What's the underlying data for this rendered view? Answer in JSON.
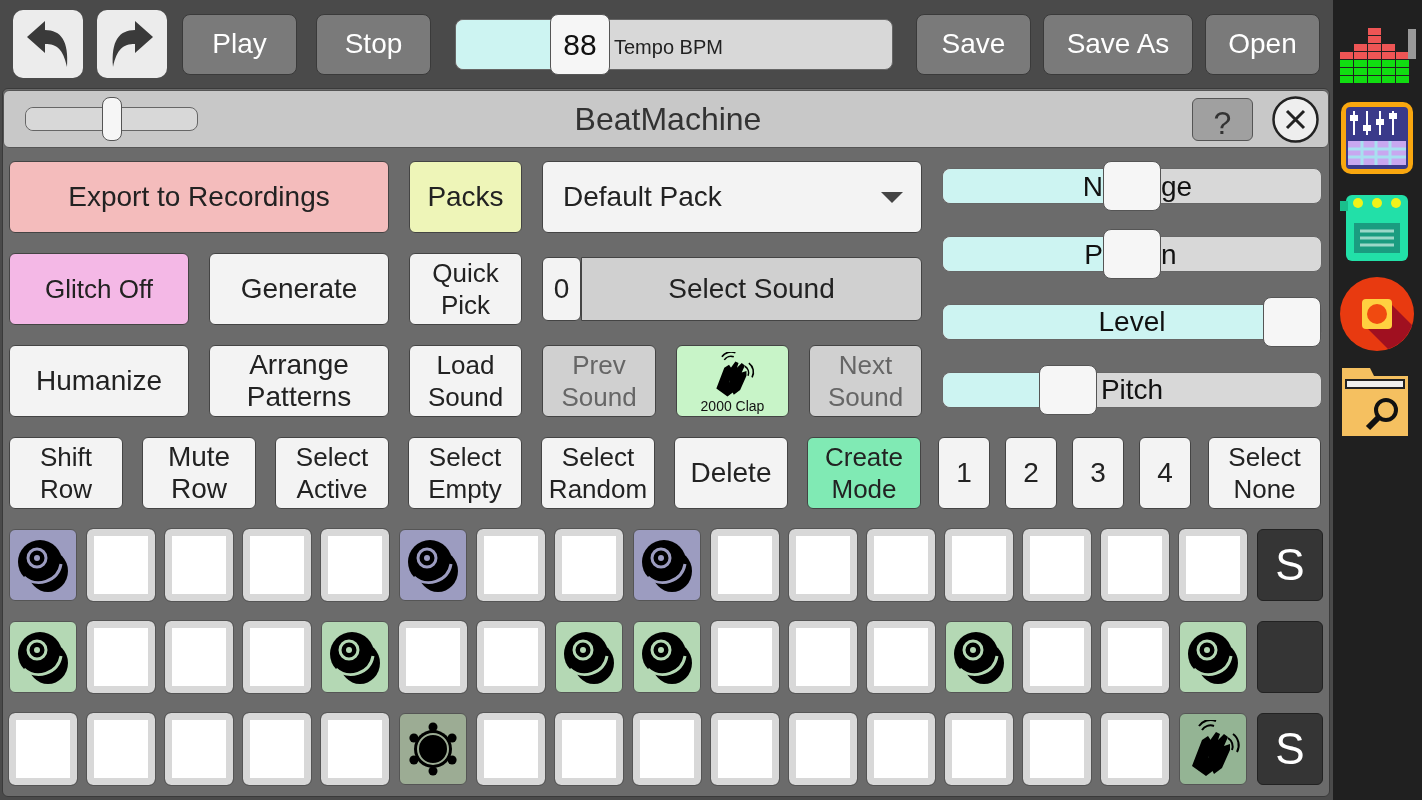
{
  "toolbar": {
    "history_buttons": [
      {
        "kind": "undo"
      },
      {
        "kind": "redo"
      }
    ],
    "transport_buttons": [
      "Play",
      "Stop"
    ],
    "tempo": {
      "value": "88",
      "label": "Tempo BPM",
      "level": 0.25
    },
    "file_buttons": [
      "Save",
      "Save As",
      "Open"
    ]
  },
  "window": {
    "title": "BeatMachine",
    "zoom_slider": {
      "level": 0.5
    },
    "help_label": "?"
  },
  "control_rows": [
    [
      {
        "kind": "button",
        "label": "Export to Recordings",
        "color": "#f4bcbc"
      },
      {
        "kind": "button",
        "label": "Packs",
        "color": "#eef5b8"
      },
      {
        "kind": "dropdown",
        "value": "Default Pack"
      }
    ],
    [
      {
        "kind": "button",
        "label": "Glitch Off",
        "color": "#f4b8e6"
      },
      {
        "kind": "button",
        "label": "Generate",
        "color": "#f3f3f3"
      },
      {
        "kind": "button",
        "label": "Quick Pick",
        "color": "#f3f3f3"
      },
      {
        "kind": "sound-select",
        "index": "0",
        "label": "Select Sound"
      }
    ],
    [
      {
        "kind": "button",
        "label": "Humanize",
        "color": "#f3f3f3"
      },
      {
        "kind": "button",
        "label": "Arrange Patterns",
        "color": "#f3f3f3"
      },
      {
        "kind": "button",
        "label": "Load Sound",
        "color": "#f3f3f3"
      },
      {
        "kind": "button",
        "label": "Prev Sound",
        "color": "#d0d0d0",
        "disabled": true
      },
      {
        "kind": "sound-pad",
        "label": "2000 Clap",
        "color": "#c8f4c8"
      },
      {
        "kind": "button",
        "label": "Next Sound",
        "color": "#d0d0d0",
        "disabled": true
      }
    ],
    [
      {
        "kind": "button",
        "label": "Shift Row",
        "color": "#f3f3f3"
      },
      {
        "kind": "button",
        "label": "Mute Row",
        "color": "#f3f3f3"
      },
      {
        "kind": "button",
        "label": "Select Active",
        "color": "#f3f3f3"
      },
      {
        "kind": "button",
        "label": "Select Empty",
        "color": "#f3f3f3"
      },
      {
        "kind": "button",
        "label": "Select Random",
        "color": "#f3f3f3"
      },
      {
        "kind": "button",
        "label": "Delete",
        "color": "#f3f3f3"
      },
      {
        "kind": "button",
        "label": "Create Mode",
        "color": "#80eab4"
      },
      {
        "kind": "button",
        "label": "1",
        "color": "#f3f3f3"
      },
      {
        "kind": "button",
        "label": "2",
        "color": "#f3f3f3"
      },
      {
        "kind": "button",
        "label": "3",
        "color": "#f3f3f3"
      },
      {
        "kind": "button",
        "label": "4",
        "color": "#f3f3f3"
      },
      {
        "kind": "button",
        "label": "Select None",
        "color": "#f3f3f3"
      }
    ]
  ],
  "sliders": [
    {
      "label_parts": [
        "N",
        "ge"
      ],
      "level": 0.5
    },
    {
      "label_parts": [
        "P",
        "n"
      ],
      "level": 0.5
    },
    {
      "label": "Level",
      "level": 1
    },
    {
      "label": "Pitch",
      "level": 0.3
    }
  ],
  "pattern_rows": [
    {
      "solo_label": "S",
      "steps": [
        {
          "kind": "drum",
          "color": "#9c9cc0"
        },
        {
          "kind": "empty"
        },
        {
          "kind": "empty"
        },
        {
          "kind": "empty"
        },
        {
          "kind": "empty"
        },
        {
          "kind": "drum",
          "color": "#9c9cc0"
        },
        {
          "kind": "empty"
        },
        {
          "kind": "empty"
        },
        {
          "kind": "drum",
          "color": "#9c9cc0"
        },
        {
          "kind": "empty"
        },
        {
          "kind": "empty"
        },
        {
          "kind": "empty"
        },
        {
          "kind": "empty"
        },
        {
          "kind": "empty"
        },
        {
          "kind": "empty"
        },
        {
          "kind": "empty"
        }
      ]
    },
    {
      "steps": [
        {
          "kind": "drum",
          "color": "#b4d8b4"
        },
        {
          "kind": "empty"
        },
        {
          "kind": "empty"
        },
        {
          "kind": "empty"
        },
        {
          "kind": "drum",
          "color": "#b4d8b4"
        },
        {
          "kind": "empty"
        },
        {
          "kind": "empty"
        },
        {
          "kind": "drum",
          "color": "#b4d8b4"
        },
        {
          "kind": "drum",
          "color": "#b4d8b4"
        },
        {
          "kind": "empty"
        },
        {
          "kind": "empty"
        },
        {
          "kind": "empty"
        },
        {
          "kind": "drum",
          "color": "#b4d8b4"
        },
        {
          "kind": "empty"
        },
        {
          "kind": "empty"
        },
        {
          "kind": "drum",
          "color": "#b4d8b4"
        }
      ]
    },
    {
      "solo_label": "S",
      "steps": [
        {
          "kind": "empty"
        },
        {
          "kind": "empty"
        },
        {
          "kind": "empty"
        },
        {
          "kind": "empty"
        },
        {
          "kind": "empty"
        },
        {
          "kind": "tambourine",
          "color": "#9cac94"
        },
        {
          "kind": "empty"
        },
        {
          "kind": "empty"
        },
        {
          "kind": "empty"
        },
        {
          "kind": "empty"
        },
        {
          "kind": "empty"
        },
        {
          "kind": "empty"
        },
        {
          "kind": "empty"
        },
        {
          "kind": "empty"
        },
        {
          "kind": "empty"
        },
        {
          "kind": "clap",
          "color": "#94b494"
        }
      ]
    }
  ],
  "app_dock": [
    {
      "kind": "equalizer"
    },
    {
      "kind": "mixer"
    },
    {
      "kind": "robot"
    },
    {
      "kind": "recorder"
    },
    {
      "kind": "file-browser"
    }
  ]
}
